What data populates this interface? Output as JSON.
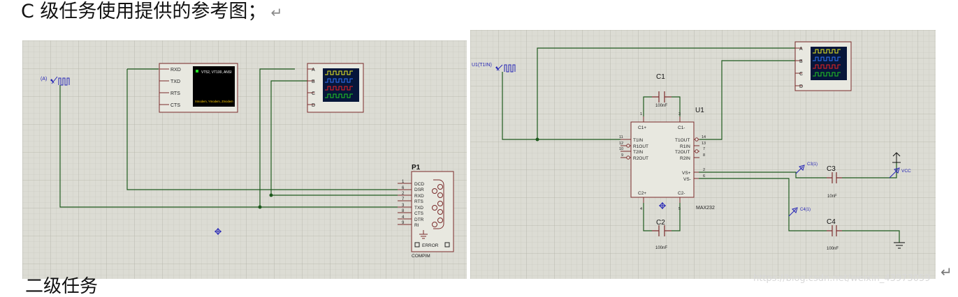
{
  "heading": {
    "text": "C 级任务使用提供的参考图；",
    "return_mark": "↵"
  },
  "bottom_text": "二级任务",
  "watermark": "https://blog.csdn.net/weixin_43973059",
  "return_mark_right": "↵",
  "colors": {
    "grid_bg": "#dcdcd4",
    "wire": "#1e5a1e",
    "component": "#7a2a2a",
    "probe": "#2323b4",
    "scope_screen": "#06163a"
  },
  "left": {
    "probe_label": "(A)",
    "terminal": {
      "pins": [
        "RXD",
        "TXD",
        "RTS",
        "CTS"
      ],
      "screen_title": "VT52, VT100, ANSI",
      "screen_footer": "Xmodem, Ymodem, Zmodem"
    },
    "scope_pins": [
      "A",
      "B",
      "C",
      "D"
    ],
    "connector": {
      "ref": "P1",
      "pin_numbers": [
        "1",
        "6",
        "2",
        "7",
        "3",
        "8",
        "4",
        "9"
      ],
      "pin_names": [
        "DCD",
        "DSR",
        "RXD",
        "RTS",
        "TXD",
        "CTS",
        "DTR",
        "RI"
      ],
      "error_label": "ERROR",
      "part_name": "COMPIM"
    }
  },
  "right": {
    "probe_label": "U1(T1IN)",
    "scope_pins": [
      "A",
      "B",
      "C",
      "D"
    ],
    "chip": {
      "ref": "U1",
      "part": "MAX232",
      "top_pins": [
        "C1+",
        "C1-"
      ],
      "top_nums": [
        "1",
        "3"
      ],
      "bottom_pins": [
        "C2+",
        "C2-"
      ],
      "bottom_nums": [
        "4",
        "5"
      ],
      "left_pins": [
        "T1IN",
        "R1OUT",
        "T2IN",
        "R2OUT"
      ],
      "left_nums": [
        "11",
        "12",
        "10",
        "9"
      ],
      "right_pins": [
        "T1OUT",
        "R1IN",
        "T2OUT",
        "R2IN"
      ],
      "right_nums": [
        "14",
        "13",
        "7",
        "8"
      ],
      "vs_pins": [
        "VS+",
        "VS-"
      ],
      "vs_nums": [
        "2",
        "6"
      ]
    },
    "caps": [
      {
        "ref": "C1",
        "value": "100nF"
      },
      {
        "ref": "C2",
        "value": "100nF"
      },
      {
        "ref": "C3",
        "value": "10nF"
      },
      {
        "ref": "C4",
        "value": "100nF"
      }
    ],
    "probe_c3": "C3(1)",
    "probe_c4": "C4(1)",
    "vcc_label": "VCC"
  }
}
